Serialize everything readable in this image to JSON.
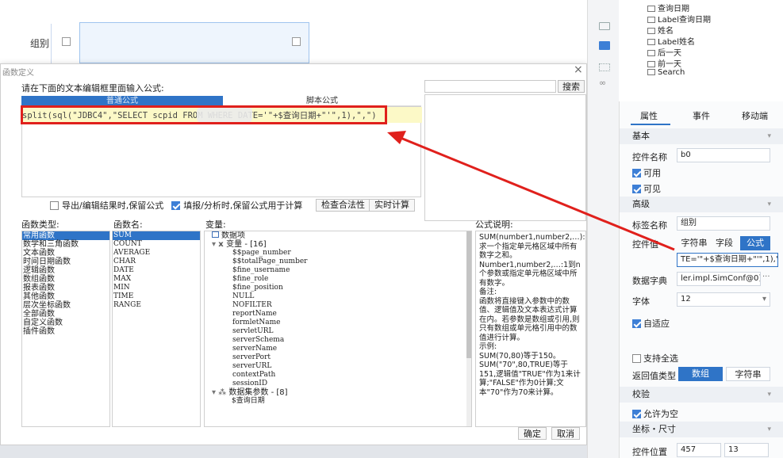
{
  "background": {
    "group_label": "组别"
  },
  "dialog": {
    "title": "函数定义",
    "close": "×",
    "prompt": "请在下面的文本编辑框里面输入公式:",
    "search_button": "搜索",
    "tab_normal": "普通公式",
    "tab_script": "脚本公式",
    "formula": "split(sql(\"JDBC4\",\"SELECT scpid FROM            WHERE DATE='\"+$查询日期+\"'\",1),\",\")",
    "option_keep_export": "导出/编辑结果时,保留公式",
    "option_keep_fill": "填报/分析时,保留公式用于计算",
    "check_button": "检查合法性",
    "calc_button": "实时计算",
    "label_types": "函数类型:",
    "label_names": "函数名:",
    "label_vars": "变量:",
    "label_desc": "公式说明:",
    "function_types": [
      "常用函数",
      "数学和三角函数",
      "文本函数",
      "时间日期函数",
      "逻辑函数",
      "数组函数",
      "报表函数",
      "其他函数",
      "层次坐标函数",
      "全部函数",
      "自定义函数",
      "插件函数"
    ],
    "function_names": [
      "SUM",
      "COUNT",
      "AVERAGE",
      "CHAR",
      "DATE",
      "MAX",
      "MIN",
      "TIME",
      "RANGE"
    ],
    "var_root": "数据项",
    "var_group": "变量 - [16]",
    "variables": [
      "$$page_number",
      "$$totalPage_number",
      "$fine_username",
      "$fine_role",
      "$fine_position",
      "NULL",
      "NOFILTER",
      "reportName",
      "formletName",
      "servletURL",
      "serverSchema",
      "serverName",
      "serverPort",
      "serverURL",
      "contextPath",
      "sessionID"
    ],
    "var_params": "数据集参数 - [8]",
    "var_param_first": "$查询日期",
    "description": "SUM(number1,number2,…):求一个指定单元格区域中所有数字之和。\nNumber1,number2,…:1到n个参数或指定单元格区域中所有数字。\n备注:\n函数将直接键入参数中的数值、逻辑值及文本表达式计算在内。若参数是数组或引用,则只有数组或单元格引用中的数值进行计算。\n示例:\nSUM(70,80)等于150。\nSUM(\"70\",80,TRUE)等于151,逻辑值\"TRUE\"作为1来计算;\"FALSE\"作为0计算;文本\"70\"作为70来计算。",
    "ok_button": "确定",
    "cancel_button": "取消"
  },
  "components": [
    "查询日期",
    "Label查询日期",
    "姓名",
    "Label姓名",
    "后一天",
    "前一天",
    "Search"
  ],
  "props": {
    "tab_attr": "属性",
    "tab_event": "事件",
    "tab_mobile": "移动端",
    "sec_basic": "基本",
    "name_label": "控件名称",
    "name_value": "b0",
    "enabled": "可用",
    "visible": "可见",
    "sec_advanced": "高级",
    "tag_label": "标签名称",
    "tag_value": "组别",
    "value_label": "控件值",
    "seg_string": "字符串",
    "seg_field": "字段",
    "seg_formula": "公式",
    "value_formula": "TE='\"+$查询日期+\"'\",1),\",\")",
    "dict_label": "数据字典",
    "dict_value": "ler.impl.SimConf@0]",
    "dict_more": "···",
    "font_label": "字体",
    "font_value": "12",
    "autofit": "自适应",
    "select_all": "支持全选",
    "return_label": "返回值类型",
    "return_array": "数组",
    "return_string": "字符串",
    "sec_validate": "校验",
    "allow_empty": "允许为空",
    "sec_coord": "坐标・尺寸",
    "pos_label": "控件位置",
    "pos_x": "457",
    "pos_y": "13"
  },
  "colors": {
    "accent": "#2f74c7",
    "annotation": "#e0201c",
    "editor_bg": "#fcf9c7"
  }
}
